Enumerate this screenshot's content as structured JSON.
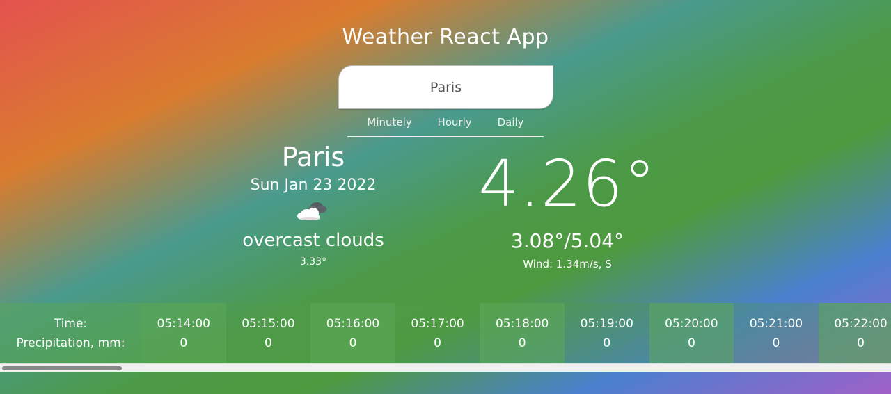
{
  "header": {
    "title": "Weather React App"
  },
  "search": {
    "value": "Paris"
  },
  "tabs": [
    {
      "label": "Minutely"
    },
    {
      "label": "Hourly"
    },
    {
      "label": "Daily"
    }
  ],
  "current": {
    "city": "Paris",
    "date": "Sun Jan 23 2022",
    "icon": "cloud-icon",
    "description": "overcast clouds",
    "feels_like": "3.33°",
    "temperature": "4.26°",
    "min_max": "3.08°/5.04°",
    "wind": "Wind: 1.34m/s, S"
  },
  "forecast": {
    "time_label": "Time:",
    "precip_label": "Precipitation, mm:",
    "items": [
      {
        "time": "05:14:00",
        "precip": "0"
      },
      {
        "time": "05:15:00",
        "precip": "0"
      },
      {
        "time": "05:16:00",
        "precip": "0"
      },
      {
        "time": "05:17:00",
        "precip": "0"
      },
      {
        "time": "05:18:00",
        "precip": "0"
      },
      {
        "time": "05:19:00",
        "precip": "0"
      },
      {
        "time": "05:20:00",
        "precip": "0"
      },
      {
        "time": "05:21:00",
        "precip": "0"
      },
      {
        "time": "05:22:00",
        "precip": "0"
      }
    ]
  }
}
